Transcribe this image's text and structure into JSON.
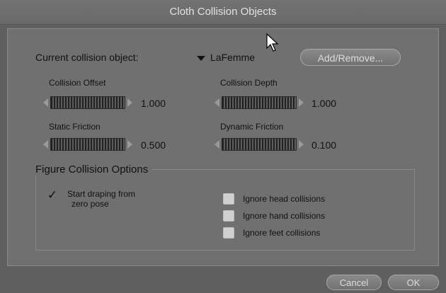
{
  "window": {
    "title": "Cloth Collision Objects"
  },
  "current": {
    "label": "Current collision object:",
    "object_name": "LaFemme",
    "add_remove_label": "Add/Remove..."
  },
  "dials": {
    "collision_offset": {
      "label": "Collision Offset",
      "value": "1.000"
    },
    "collision_depth": {
      "label": "Collision Depth",
      "value": "1.000"
    },
    "static_friction": {
      "label": "Static Friction",
      "value": "0.500"
    },
    "dynamic_friction": {
      "label": "Dynamic Friction",
      "value": "0.100"
    }
  },
  "options": {
    "group_title": "Figure Collision Options",
    "start_draping_line1": "Start draping from",
    "start_draping_line2": "zero pose",
    "start_draping_checked": true,
    "ignore_head": "Ignore head collisions",
    "ignore_hand": "Ignore hand collisions",
    "ignore_feet": "Ignore feet collisions"
  },
  "footer": {
    "cancel_label": "Cancel",
    "ok_label": "OK"
  }
}
